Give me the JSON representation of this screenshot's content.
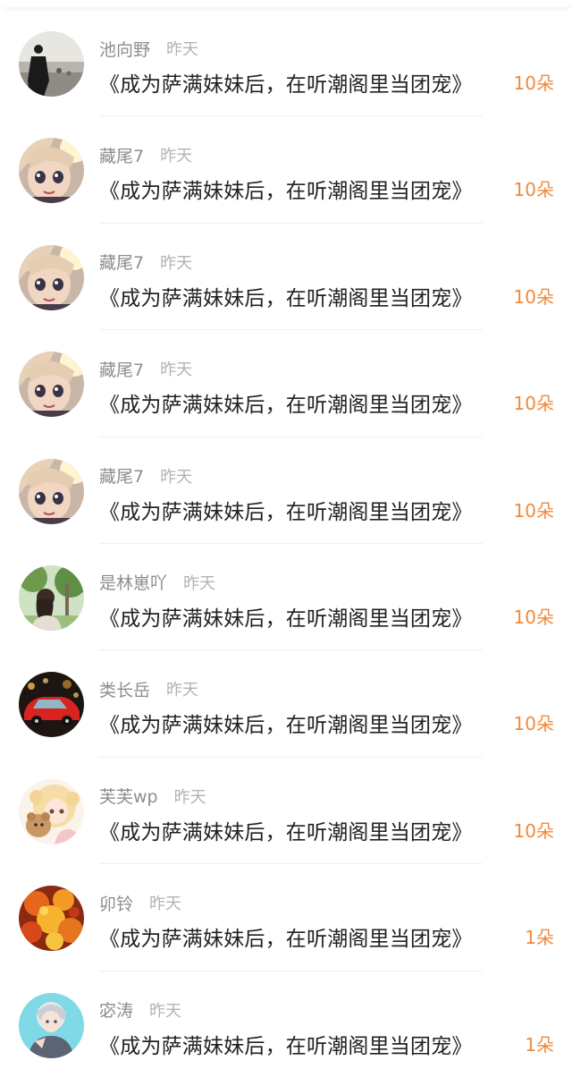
{
  "colors": {
    "username": "#8d8d8d",
    "time": "#b3b3b3",
    "title": "#222222",
    "count": "#f08a3c",
    "divider": "#efefef"
  },
  "rows": [
    {
      "username": "池向野",
      "time": "昨天",
      "title": "《成为萨满妹妹后，在听潮阁里当团宠》",
      "count": "10朵",
      "avatar": "man-by-sea-avatar"
    },
    {
      "username": "藏尾7",
      "time": "昨天",
      "title": "《成为萨满妹妹后，在听潮阁里当团宠》",
      "count": "10朵",
      "avatar": "anime-girl-avatar"
    },
    {
      "username": "藏尾7",
      "time": "昨天",
      "title": "《成为萨满妹妹后，在听潮阁里当团宠》",
      "count": "10朵",
      "avatar": "anime-girl-avatar"
    },
    {
      "username": "藏尾7",
      "time": "昨天",
      "title": "《成为萨满妹妹后，在听潮阁里当团宠》",
      "count": "10朵",
      "avatar": "anime-girl-avatar"
    },
    {
      "username": "藏尾7",
      "time": "昨天",
      "title": "《成为萨满妹妹后，在听潮阁里当团宠》",
      "count": "10朵",
      "avatar": "anime-girl-avatar"
    },
    {
      "username": "是林崽吖",
      "time": "昨天",
      "title": "《成为萨满妹妹后，在听潮阁里当团宠》",
      "count": "10朵",
      "avatar": "girl-in-park-avatar"
    },
    {
      "username": "类长岳",
      "time": "昨天",
      "title": "《成为萨满妹妹后，在听潮阁里当团宠》",
      "count": "10朵",
      "avatar": "red-car-avatar"
    },
    {
      "username": "芙芙wp",
      "time": "昨天",
      "title": "《成为萨满妹妹后，在听潮阁里当团宠》",
      "count": "10朵",
      "avatar": "cartoon-girl-bear-avatar"
    },
    {
      "username": "卯铃",
      "time": "昨天",
      "title": "《成为萨满妹妹后，在听潮阁里当团宠》",
      "count": "1朵",
      "avatar": "autumn-leaves-avatar"
    },
    {
      "username": "宓涛",
      "time": "昨天",
      "title": "《成为萨满妹妹后，在听潮阁里当团宠》",
      "count": "1朵",
      "avatar": "anime-boy-avatar"
    }
  ]
}
